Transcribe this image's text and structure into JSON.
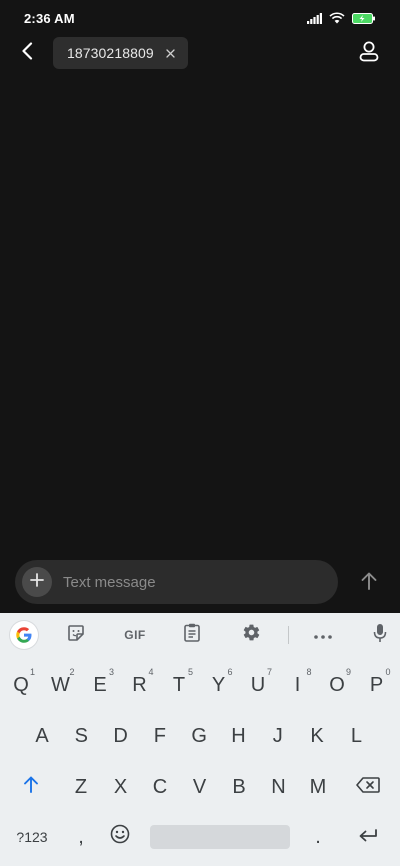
{
  "status_bar": {
    "time": "2:36 AM",
    "icons": [
      "signal-icon",
      "wifi-icon",
      "battery-charging-icon"
    ],
    "battery_color": "#4cd964"
  },
  "header": {
    "back_icon": "back-arrow-icon",
    "recipient": "18730218809",
    "remove_icon": "close-icon",
    "contact_icon": "person-icon"
  },
  "compose": {
    "attach_icon": "plus-icon",
    "placeholder": "Text message",
    "send_icon": "send-up-arrow-icon"
  },
  "keyboard": {
    "toolbar": {
      "google_label": "G",
      "sticker_icon": "sticker-icon",
      "gif_label": "GIF",
      "clipboard_icon": "clipboard-icon",
      "settings_icon": "gear-icon",
      "more_icon": "more-dots-icon",
      "mic_icon": "microphone-icon"
    },
    "row1": [
      {
        "k": "Q",
        "h": "1"
      },
      {
        "k": "W",
        "h": "2"
      },
      {
        "k": "E",
        "h": "3"
      },
      {
        "k": "R",
        "h": "4"
      },
      {
        "k": "T",
        "h": "5"
      },
      {
        "k": "Y",
        "h": "6"
      },
      {
        "k": "U",
        "h": "7"
      },
      {
        "k": "I",
        "h": "8"
      },
      {
        "k": "O",
        "h": "9"
      },
      {
        "k": "P",
        "h": "0"
      }
    ],
    "row2": [
      "A",
      "S",
      "D",
      "F",
      "G",
      "H",
      "J",
      "K",
      "L"
    ],
    "row3": [
      "Z",
      "X",
      "C",
      "V",
      "B",
      "N",
      "M"
    ],
    "shift_icon": "shift-arrow-icon",
    "backspace_icon": "backspace-icon",
    "symbols_label": "?123",
    "comma_label": ",",
    "emoji_icon": "emoji-icon",
    "period_label": ".",
    "enter_icon": "enter-icon",
    "accent_color": "#1a73e8"
  }
}
